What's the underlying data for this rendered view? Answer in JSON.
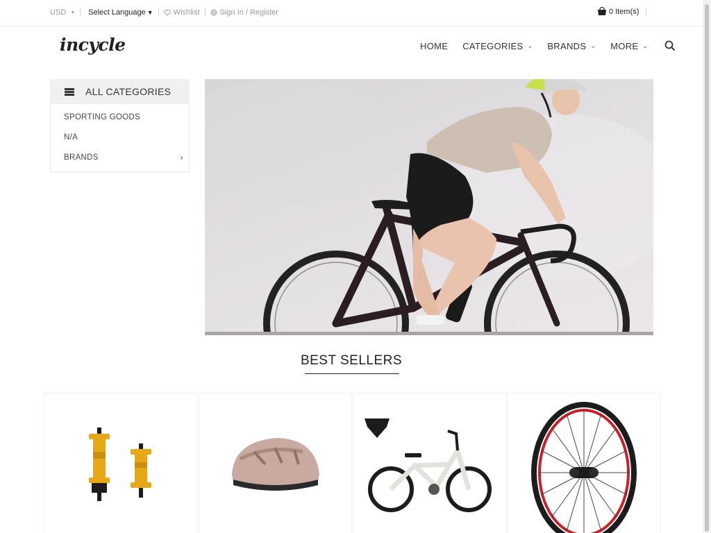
{
  "topbar": {
    "currency": "USD",
    "language": "Select Language",
    "wishlist": "Wishlist",
    "signin": "Sign In / Register",
    "cart": "0 Item(s)"
  },
  "header": {
    "logo": "incycle",
    "nav": [
      {
        "label": "HOME"
      },
      {
        "label": "CATEGORIES"
      },
      {
        "label": "BRANDS"
      },
      {
        "label": "MORE"
      }
    ]
  },
  "sidebar": {
    "heading": "ALL CATEGORIES",
    "items": [
      {
        "label": "SPORTING GOODS"
      },
      {
        "label": "N/A"
      },
      {
        "label": "BRANDS"
      }
    ]
  },
  "best_sellers": {
    "title": "BEST SELLERS"
  },
  "colors": {
    "accent": "#222222",
    "hub_gold": "#e6a817",
    "helmet_pink": "#c9aaa0",
    "rim_red": "#c8202a"
  },
  "icons": [
    "heart-icon",
    "globe-icon",
    "cart-icon",
    "search-icon",
    "menu-bars-icon",
    "chevron-down-icon",
    "chevron-right-icon"
  ]
}
